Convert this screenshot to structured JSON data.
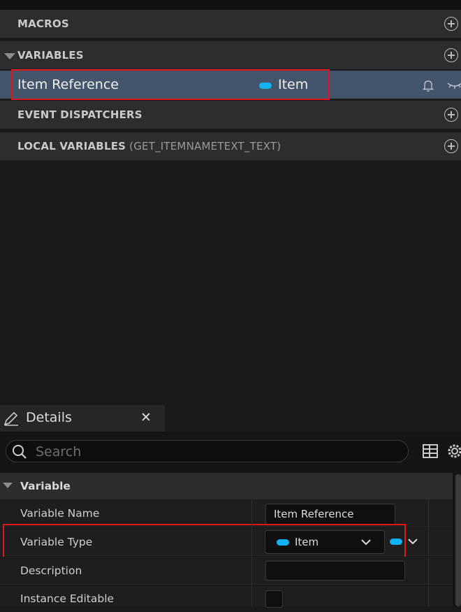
{
  "my_blueprint": {
    "sections": {
      "macros": "MACROS",
      "variables": "VARIABLES",
      "event_dispatchers": "EVENT DISPATCHERS",
      "local_variables": "LOCAL VARIABLES",
      "local_variables_scope": "(GET_ITEMNAMETEXT_TEXT)"
    },
    "variable": {
      "name": "Item Reference",
      "type": "Item"
    }
  },
  "details": {
    "tab_title": "Details",
    "search_placeholder": "Search",
    "category": "Variable",
    "rows": {
      "name_label": "Variable Name",
      "name_value": "Item Reference",
      "type_label": "Variable Type",
      "type_value": "Item",
      "description_label": "Description",
      "instance_editable_label": "Instance Editable"
    }
  },
  "colors": {
    "object_pin": "#0fb2f2",
    "highlight": "#e0161c",
    "selected_row": "#44546a"
  }
}
